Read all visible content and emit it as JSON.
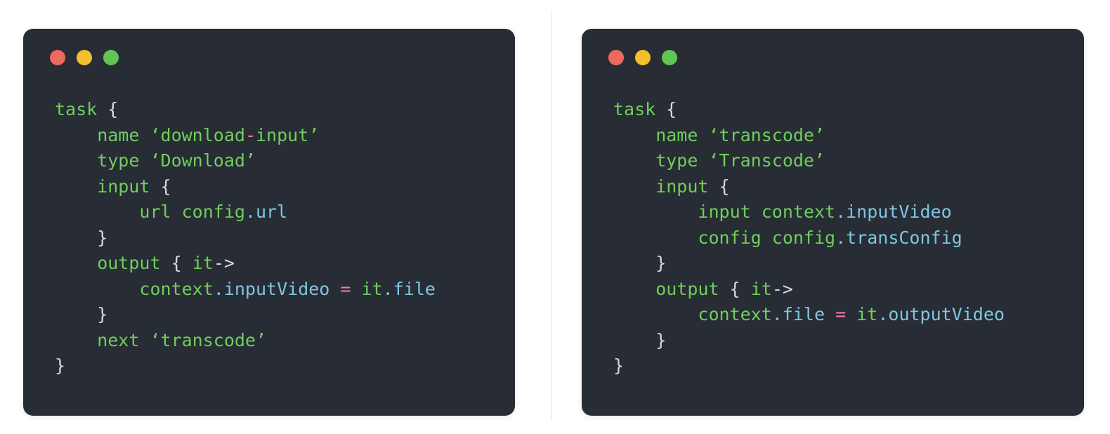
{
  "page": {
    "background_color": "#ffffff",
    "divider_color": "#f1f1f2"
  },
  "theme": {
    "card_background": "#282c35",
    "keyword_green": "#6fcf5b",
    "string_green": "#6fcf5b",
    "punctuation_gray": "#d8d8dc",
    "property_blue": "#7fc6e0",
    "operator_pink": "#f07ca0",
    "dot_red": "#ec6a5e",
    "dot_yellow": "#f3bf2e",
    "dot_green": "#61c454"
  },
  "panels": [
    {
      "id": "download-task-snippet",
      "window_controls": {
        "close_label": "close",
        "minimize_label": "minimize",
        "maximize_label": "maximize"
      },
      "code_lines": [
        [
          {
            "t": "task",
            "c": "kw"
          },
          {
            "t": " ",
            "c": "plain"
          },
          {
            "t": "{",
            "c": "punct"
          }
        ],
        [
          {
            "t": "    name ",
            "c": "kw"
          },
          {
            "t": "‘download",
            "c": "str"
          },
          {
            "t": "-",
            "c": "op"
          },
          {
            "t": "input’",
            "c": "str"
          }
        ],
        [
          {
            "t": "    type ",
            "c": "kw"
          },
          {
            "t": "‘Download’",
            "c": "str"
          }
        ],
        [
          {
            "t": "    input ",
            "c": "kw"
          },
          {
            "t": "{",
            "c": "punct"
          }
        ],
        [
          {
            "t": "        url config",
            "c": "kw"
          },
          {
            "t": ".url",
            "c": "prop"
          }
        ],
        [
          {
            "t": "    ",
            "c": "plain"
          },
          {
            "t": "}",
            "c": "punct"
          }
        ],
        [
          {
            "t": "    output ",
            "c": "kw"
          },
          {
            "t": "{",
            "c": "punct"
          },
          {
            "t": " ",
            "c": "plain"
          },
          {
            "t": "it",
            "c": "kw"
          },
          {
            "t": "->",
            "c": "punct"
          }
        ],
        [
          {
            "t": "        context",
            "c": "kw"
          },
          {
            "t": ".inputVideo",
            "c": "prop"
          },
          {
            "t": " ",
            "c": "plain"
          },
          {
            "t": "=",
            "c": "op"
          },
          {
            "t": " ",
            "c": "plain"
          },
          {
            "t": "it",
            "c": "kw"
          },
          {
            "t": ".file",
            "c": "prop"
          }
        ],
        [
          {
            "t": "    ",
            "c": "plain"
          },
          {
            "t": "}",
            "c": "punct"
          }
        ],
        [
          {
            "t": "    next ",
            "c": "kw"
          },
          {
            "t": "‘transcode’",
            "c": "str"
          }
        ],
        [
          {
            "t": "}",
            "c": "punct"
          }
        ]
      ]
    },
    {
      "id": "transcode-task-snippet",
      "window_controls": {
        "close_label": "close",
        "minimize_label": "minimize",
        "maximize_label": "maximize"
      },
      "code_lines": [
        [
          {
            "t": "task",
            "c": "kw"
          },
          {
            "t": " ",
            "c": "plain"
          },
          {
            "t": "{",
            "c": "punct"
          }
        ],
        [
          {
            "t": "    name ",
            "c": "kw"
          },
          {
            "t": "‘transcode’",
            "c": "str"
          }
        ],
        [
          {
            "t": "    type ",
            "c": "kw"
          },
          {
            "t": "‘Transcode’",
            "c": "str"
          }
        ],
        [
          {
            "t": "    input ",
            "c": "kw"
          },
          {
            "t": "{",
            "c": "punct"
          }
        ],
        [
          {
            "t": "        input context",
            "c": "kw"
          },
          {
            "t": ".inputVideo",
            "c": "prop"
          }
        ],
        [
          {
            "t": "        config config",
            "c": "kw"
          },
          {
            "t": ".transConfig",
            "c": "prop"
          }
        ],
        [
          {
            "t": "    ",
            "c": "plain"
          },
          {
            "t": "}",
            "c": "punct"
          }
        ],
        [
          {
            "t": "    output ",
            "c": "kw"
          },
          {
            "t": "{",
            "c": "punct"
          },
          {
            "t": " ",
            "c": "plain"
          },
          {
            "t": "it",
            "c": "kw"
          },
          {
            "t": "->",
            "c": "punct"
          }
        ],
        [
          {
            "t": "        context",
            "c": "kw"
          },
          {
            "t": ".file",
            "c": "prop"
          },
          {
            "t": " ",
            "c": "plain"
          },
          {
            "t": "=",
            "c": "op"
          },
          {
            "t": " ",
            "c": "plain"
          },
          {
            "t": "it",
            "c": "kw"
          },
          {
            "t": ".outputVideo",
            "c": "prop"
          }
        ],
        [
          {
            "t": "    ",
            "c": "plain"
          },
          {
            "t": "}",
            "c": "punct"
          }
        ],
        [
          {
            "t": "}",
            "c": "punct"
          }
        ]
      ]
    }
  ]
}
